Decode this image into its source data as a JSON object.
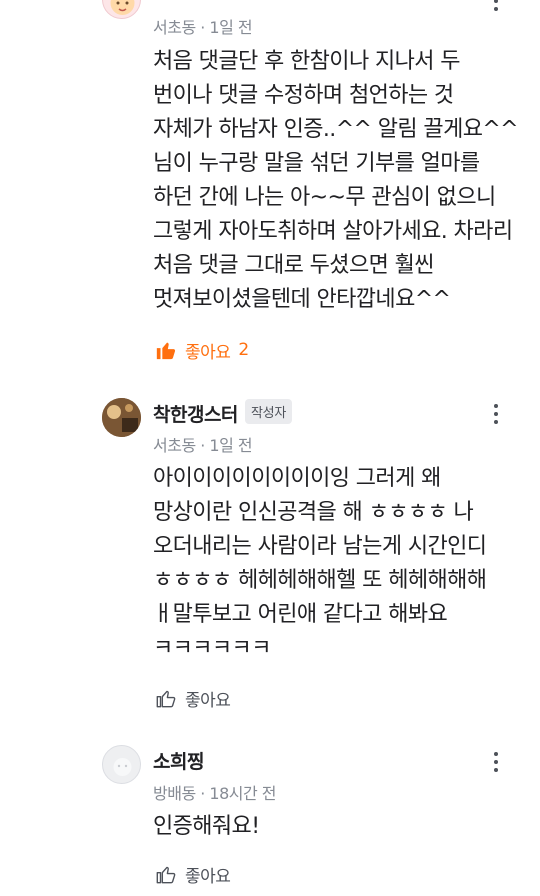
{
  "comments": [
    {
      "meta": "서초동 · 1일 전",
      "body": "처음 댓글단 후 한참이나 지나서 두 번이나 댓글 수정하며 첨언하는 것 자체가 하남자 인증..^^ 알림 끌게요^^님이 누구랑 말을 섞던 기부를 얼마를 하던 간에 나는 아~~무 관심이 없으니 그렇게 자아도취하며 살아가세요. 차라리 처음 댓글 그대로 두셨으면 훨씬 멋져보이셨을텐데 안타깝네요^^",
      "like_label": "좋아요",
      "like_count": "2"
    },
    {
      "name": "착한갱스터",
      "badge": "작성자",
      "meta": "서초동 · 1일 전",
      "body": "아이이이이이이이이잉 그러게 왜 망상이란 인신공격을 해 ㅎㅎㅎㅎ 나 오더내리는 사람이라 남는게 시간인디 ㅎㅎㅎㅎ 헤헤헤해해헬 또 헤헤해해해 ㅐ말투보고 어린애 같다고 해봐요 ㅋㅋㅋㅋㅋㅋ",
      "like_label": "좋아요"
    },
    {
      "name": "소희찡",
      "meta": "방배동 · 18시간 전",
      "body": "인증해줘요!",
      "like_label": "좋아요"
    }
  ],
  "colors": {
    "accent": "#ff6f0f",
    "muted": "#868b94",
    "badge_bg": "#eaebee"
  }
}
